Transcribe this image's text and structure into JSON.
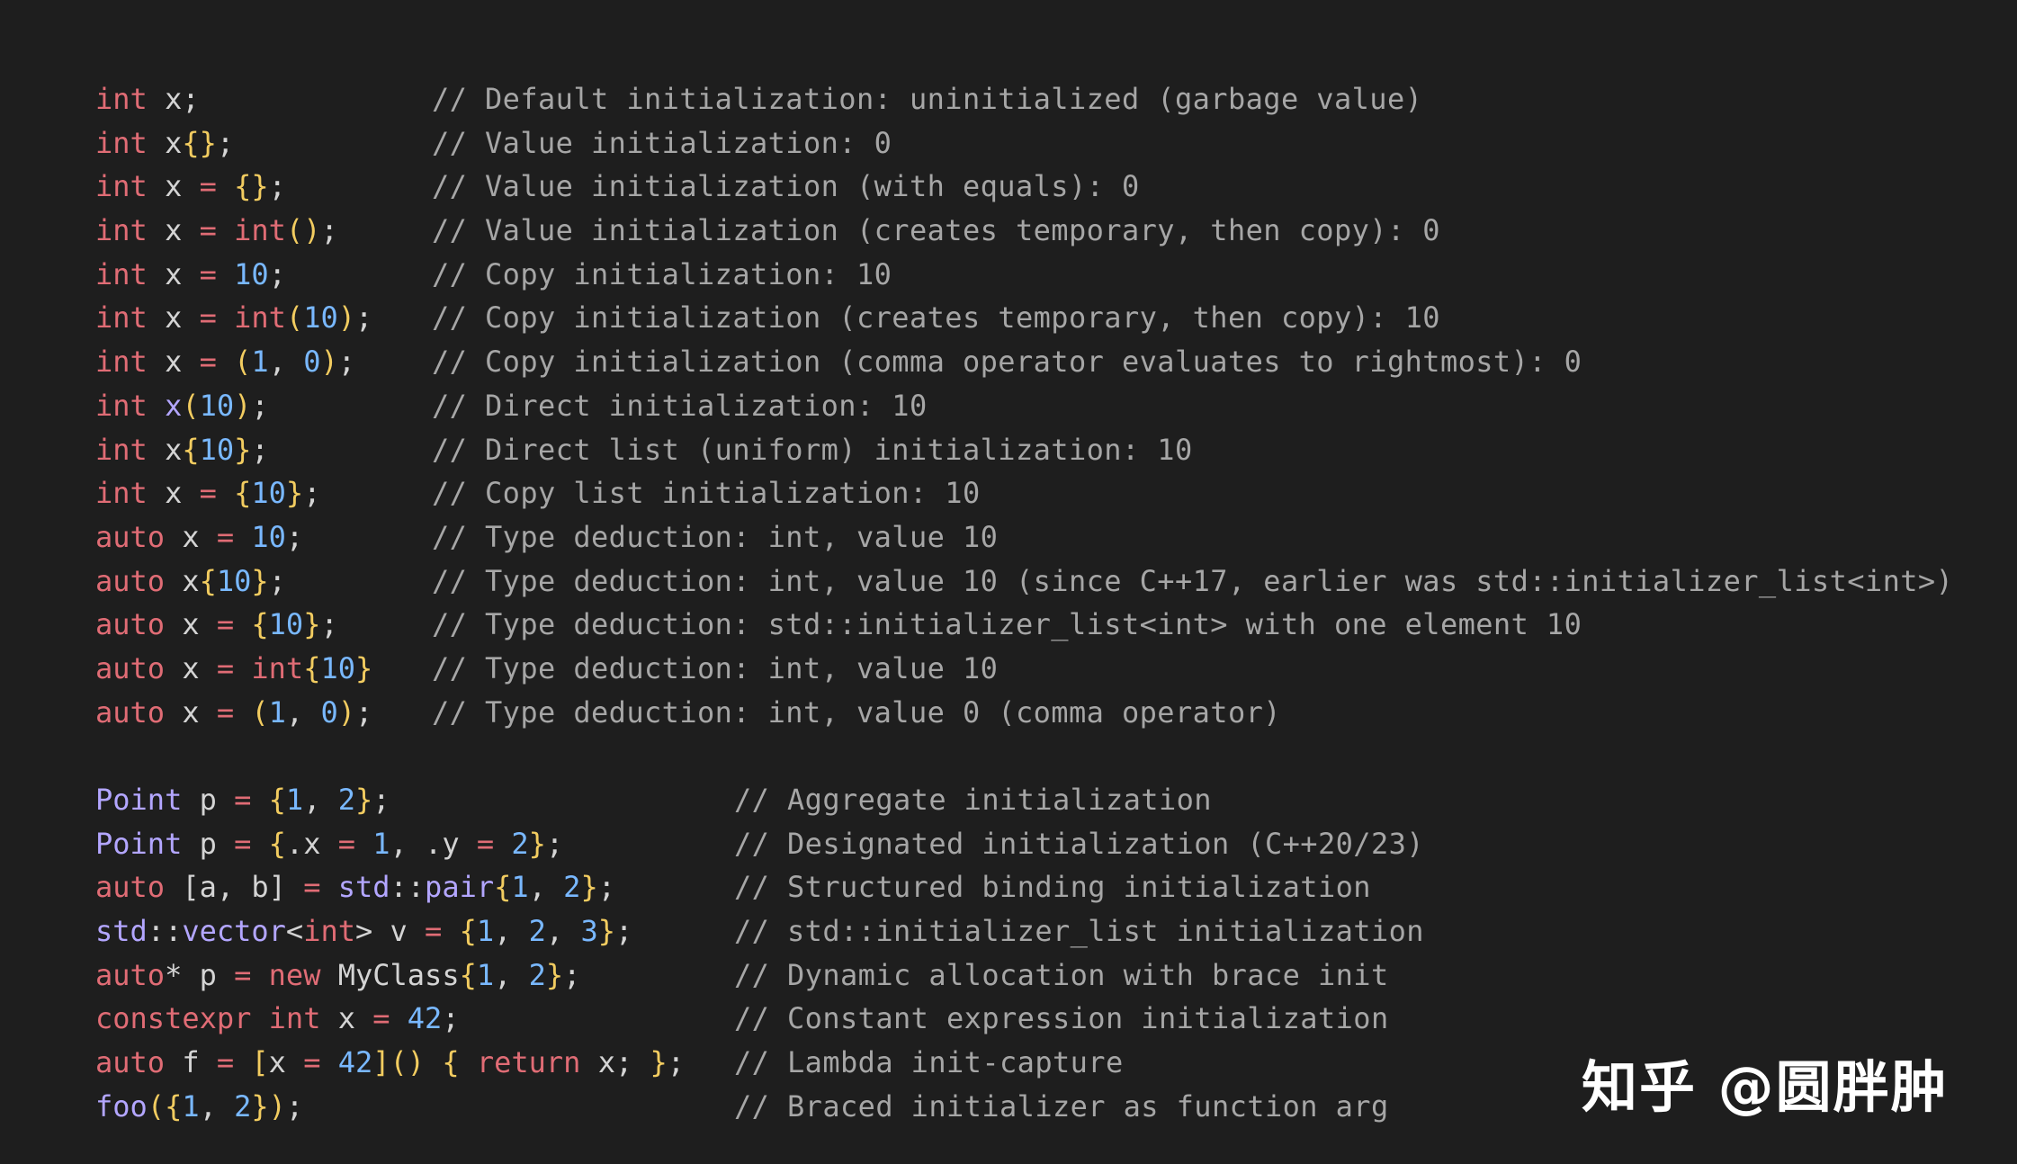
{
  "block1": [
    {
      "code": [
        [
          "k",
          "int"
        ],
        [
          "p",
          " x;"
        ]
      ],
      "comment": "// Default initialization: uninitialized (garbage value)"
    },
    {
      "code": [
        [
          "k",
          "int"
        ],
        [
          "p",
          " x"
        ],
        [
          "b",
          "{}"
        ],
        [
          "p",
          ";"
        ]
      ],
      "comment": "// Value initialization: 0"
    },
    {
      "code": [
        [
          "k",
          "int"
        ],
        [
          "p",
          " x "
        ],
        [
          "o",
          "="
        ],
        [
          "p",
          " "
        ],
        [
          "b",
          "{}"
        ],
        [
          "p",
          ";"
        ]
      ],
      "comment": "// Value initialization (with equals): 0"
    },
    {
      "code": [
        [
          "k",
          "int"
        ],
        [
          "p",
          " x "
        ],
        [
          "o",
          "="
        ],
        [
          "p",
          " "
        ],
        [
          "k",
          "int"
        ],
        [
          "b",
          "()"
        ],
        [
          "p",
          ";"
        ]
      ],
      "comment": "// Value initialization (creates temporary, then copy): 0"
    },
    {
      "code": [
        [
          "k",
          "int"
        ],
        [
          "p",
          " x "
        ],
        [
          "o",
          "="
        ],
        [
          "p",
          " "
        ],
        [
          "n",
          "10"
        ],
        [
          "p",
          ";"
        ]
      ],
      "comment": "// Copy initialization: 10"
    },
    {
      "code": [
        [
          "k",
          "int"
        ],
        [
          "p",
          " x "
        ],
        [
          "o",
          "="
        ],
        [
          "p",
          " "
        ],
        [
          "k",
          "int"
        ],
        [
          "b",
          "("
        ],
        [
          "n",
          "10"
        ],
        [
          "b",
          ")"
        ],
        [
          "p",
          ";"
        ]
      ],
      "comment": "// Copy initialization (creates temporary, then copy): 10"
    },
    {
      "code": [
        [
          "k",
          "int"
        ],
        [
          "p",
          " x "
        ],
        [
          "o",
          "="
        ],
        [
          "p",
          " "
        ],
        [
          "b",
          "("
        ],
        [
          "n",
          "1"
        ],
        [
          "p",
          ", "
        ],
        [
          "n",
          "0"
        ],
        [
          "b",
          ")"
        ],
        [
          "p",
          ";"
        ]
      ],
      "comment": "// Copy initialization (comma operator evaluates to rightmost): 0"
    },
    {
      "code": [
        [
          "k",
          "int"
        ],
        [
          "p",
          " "
        ],
        [
          "t",
          "x"
        ],
        [
          "b",
          "("
        ],
        [
          "n",
          "10"
        ],
        [
          "b",
          ")"
        ],
        [
          "p",
          ";"
        ]
      ],
      "comment": "// Direct initialization: 10"
    },
    {
      "code": [
        [
          "k",
          "int"
        ],
        [
          "p",
          " x"
        ],
        [
          "b",
          "{"
        ],
        [
          "n",
          "10"
        ],
        [
          "b",
          "}"
        ],
        [
          "p",
          ";"
        ]
      ],
      "comment": "// Direct list (uniform) initialization: 10"
    },
    {
      "code": [
        [
          "k",
          "int"
        ],
        [
          "p",
          " x "
        ],
        [
          "o",
          "="
        ],
        [
          "p",
          " "
        ],
        [
          "b",
          "{"
        ],
        [
          "n",
          "10"
        ],
        [
          "b",
          "}"
        ],
        [
          "p",
          ";"
        ]
      ],
      "comment": "// Copy list initialization: 10"
    },
    {
      "code": [
        [
          "k",
          "auto"
        ],
        [
          "p",
          " x "
        ],
        [
          "o",
          "="
        ],
        [
          "p",
          " "
        ],
        [
          "n",
          "10"
        ],
        [
          "p",
          ";"
        ]
      ],
      "comment": "// Type deduction: int, value 10"
    },
    {
      "code": [
        [
          "k",
          "auto"
        ],
        [
          "p",
          " x"
        ],
        [
          "b",
          "{"
        ],
        [
          "n",
          "10"
        ],
        [
          "b",
          "}"
        ],
        [
          "p",
          ";"
        ]
      ],
      "comment": "// Type deduction: int, value 10 (since C++17, earlier was std::initializer_list<int>)"
    },
    {
      "code": [
        [
          "k",
          "auto"
        ],
        [
          "p",
          " x "
        ],
        [
          "o",
          "="
        ],
        [
          "p",
          " "
        ],
        [
          "b",
          "{"
        ],
        [
          "n",
          "10"
        ],
        [
          "b",
          "}"
        ],
        [
          "p",
          ";"
        ]
      ],
      "comment": "// Type deduction: std::initializer_list<int> with one element 10"
    },
    {
      "code": [
        [
          "k",
          "auto"
        ],
        [
          "p",
          " x "
        ],
        [
          "o",
          "="
        ],
        [
          "p",
          " "
        ],
        [
          "k",
          "int"
        ],
        [
          "b",
          "{"
        ],
        [
          "n",
          "10"
        ],
        [
          "b",
          "}"
        ]
      ],
      "comment": "// Type deduction: int, value 10"
    },
    {
      "code": [
        [
          "k",
          "auto"
        ],
        [
          "p",
          " x "
        ],
        [
          "o",
          "="
        ],
        [
          "p",
          " "
        ],
        [
          "b",
          "("
        ],
        [
          "n",
          "1"
        ],
        [
          "p",
          ", "
        ],
        [
          "n",
          "0"
        ],
        [
          "b",
          ")"
        ],
        [
          "p",
          ";"
        ]
      ],
      "comment": "// Type deduction: int, value 0 (comma operator)"
    }
  ],
  "block2": [
    {
      "code": [
        [
          "t",
          "Point"
        ],
        [
          "p",
          " p "
        ],
        [
          "o",
          "="
        ],
        [
          "p",
          " "
        ],
        [
          "b",
          "{"
        ],
        [
          "n",
          "1"
        ],
        [
          "p",
          ", "
        ],
        [
          "n",
          "2"
        ],
        [
          "b",
          "}"
        ],
        [
          "p",
          ";"
        ]
      ],
      "comment": "// Aggregate initialization"
    },
    {
      "code": [
        [
          "t",
          "Point"
        ],
        [
          "p",
          " p "
        ],
        [
          "o",
          "="
        ],
        [
          "p",
          " "
        ],
        [
          "b",
          "{"
        ],
        [
          "p",
          ".x "
        ],
        [
          "o",
          "="
        ],
        [
          "p",
          " "
        ],
        [
          "n",
          "1"
        ],
        [
          "p",
          ", .y "
        ],
        [
          "o",
          "="
        ],
        [
          "p",
          " "
        ],
        [
          "n",
          "2"
        ],
        [
          "b",
          "}"
        ],
        [
          "p",
          ";"
        ]
      ],
      "comment": "// Designated initialization (C++20/23)"
    },
    {
      "code": [
        [
          "k",
          "auto"
        ],
        [
          "p",
          " [a, b] "
        ],
        [
          "o",
          "="
        ],
        [
          "p",
          " "
        ],
        [
          "t",
          "std"
        ],
        [
          "p",
          "::"
        ],
        [
          "t",
          "pair"
        ],
        [
          "b",
          "{"
        ],
        [
          "n",
          "1"
        ],
        [
          "p",
          ", "
        ],
        [
          "n",
          "2"
        ],
        [
          "b",
          "}"
        ],
        [
          "p",
          ";"
        ]
      ],
      "comment": "// Structured binding initialization"
    },
    {
      "code": [
        [
          "t",
          "std"
        ],
        [
          "p",
          "::"
        ],
        [
          "t",
          "vector"
        ],
        [
          "p",
          "<"
        ],
        [
          "k",
          "int"
        ],
        [
          "p",
          "> v "
        ],
        [
          "o",
          "="
        ],
        [
          "p",
          " "
        ],
        [
          "b",
          "{"
        ],
        [
          "n",
          "1"
        ],
        [
          "p",
          ", "
        ],
        [
          "n",
          "2"
        ],
        [
          "p",
          ", "
        ],
        [
          "n",
          "3"
        ],
        [
          "b",
          "}"
        ],
        [
          "p",
          ";"
        ]
      ],
      "comment": "// std::initializer_list initialization"
    },
    {
      "code": [
        [
          "k",
          "auto"
        ],
        [
          "p",
          "* p "
        ],
        [
          "o",
          "="
        ],
        [
          "p",
          " "
        ],
        [
          "k",
          "new"
        ],
        [
          "p",
          " MyClass"
        ],
        [
          "b",
          "{"
        ],
        [
          "n",
          "1"
        ],
        [
          "p",
          ", "
        ],
        [
          "n",
          "2"
        ],
        [
          "b",
          "}"
        ],
        [
          "p",
          ";"
        ]
      ],
      "comment": "// Dynamic allocation with brace init"
    },
    {
      "code": [
        [
          "k",
          "constexpr"
        ],
        [
          "p",
          " "
        ],
        [
          "k",
          "int"
        ],
        [
          "p",
          " x "
        ],
        [
          "o",
          "="
        ],
        [
          "p",
          " "
        ],
        [
          "n",
          "42"
        ],
        [
          "p",
          ";"
        ]
      ],
      "comment": "// Constant expression initialization"
    },
    {
      "code": [
        [
          "k",
          "auto"
        ],
        [
          "p",
          " f "
        ],
        [
          "o",
          "="
        ],
        [
          "p",
          " "
        ],
        [
          "b",
          "["
        ],
        [
          "p",
          "x "
        ],
        [
          "o",
          "="
        ],
        [
          "p",
          " "
        ],
        [
          "n",
          "42"
        ],
        [
          "b",
          "]()"
        ],
        [
          "p",
          " "
        ],
        [
          "b",
          "{"
        ],
        [
          "p",
          " "
        ],
        [
          "k",
          "return"
        ],
        [
          "p",
          " x; "
        ],
        [
          "b",
          "}"
        ],
        [
          "p",
          ";"
        ]
      ],
      "comment": "// Lambda init-capture"
    },
    {
      "code": [
        [
          "t",
          "foo"
        ],
        [
          "b",
          "("
        ],
        [
          "b",
          "{"
        ],
        [
          "n",
          "1"
        ],
        [
          "p",
          ", "
        ],
        [
          "n",
          "2"
        ],
        [
          "b",
          "}"
        ],
        [
          "b",
          ")"
        ],
        [
          "p",
          ";"
        ]
      ],
      "comment": "// Braced initializer as function arg"
    }
  ],
  "watermark": "知乎 @圆胖肿"
}
